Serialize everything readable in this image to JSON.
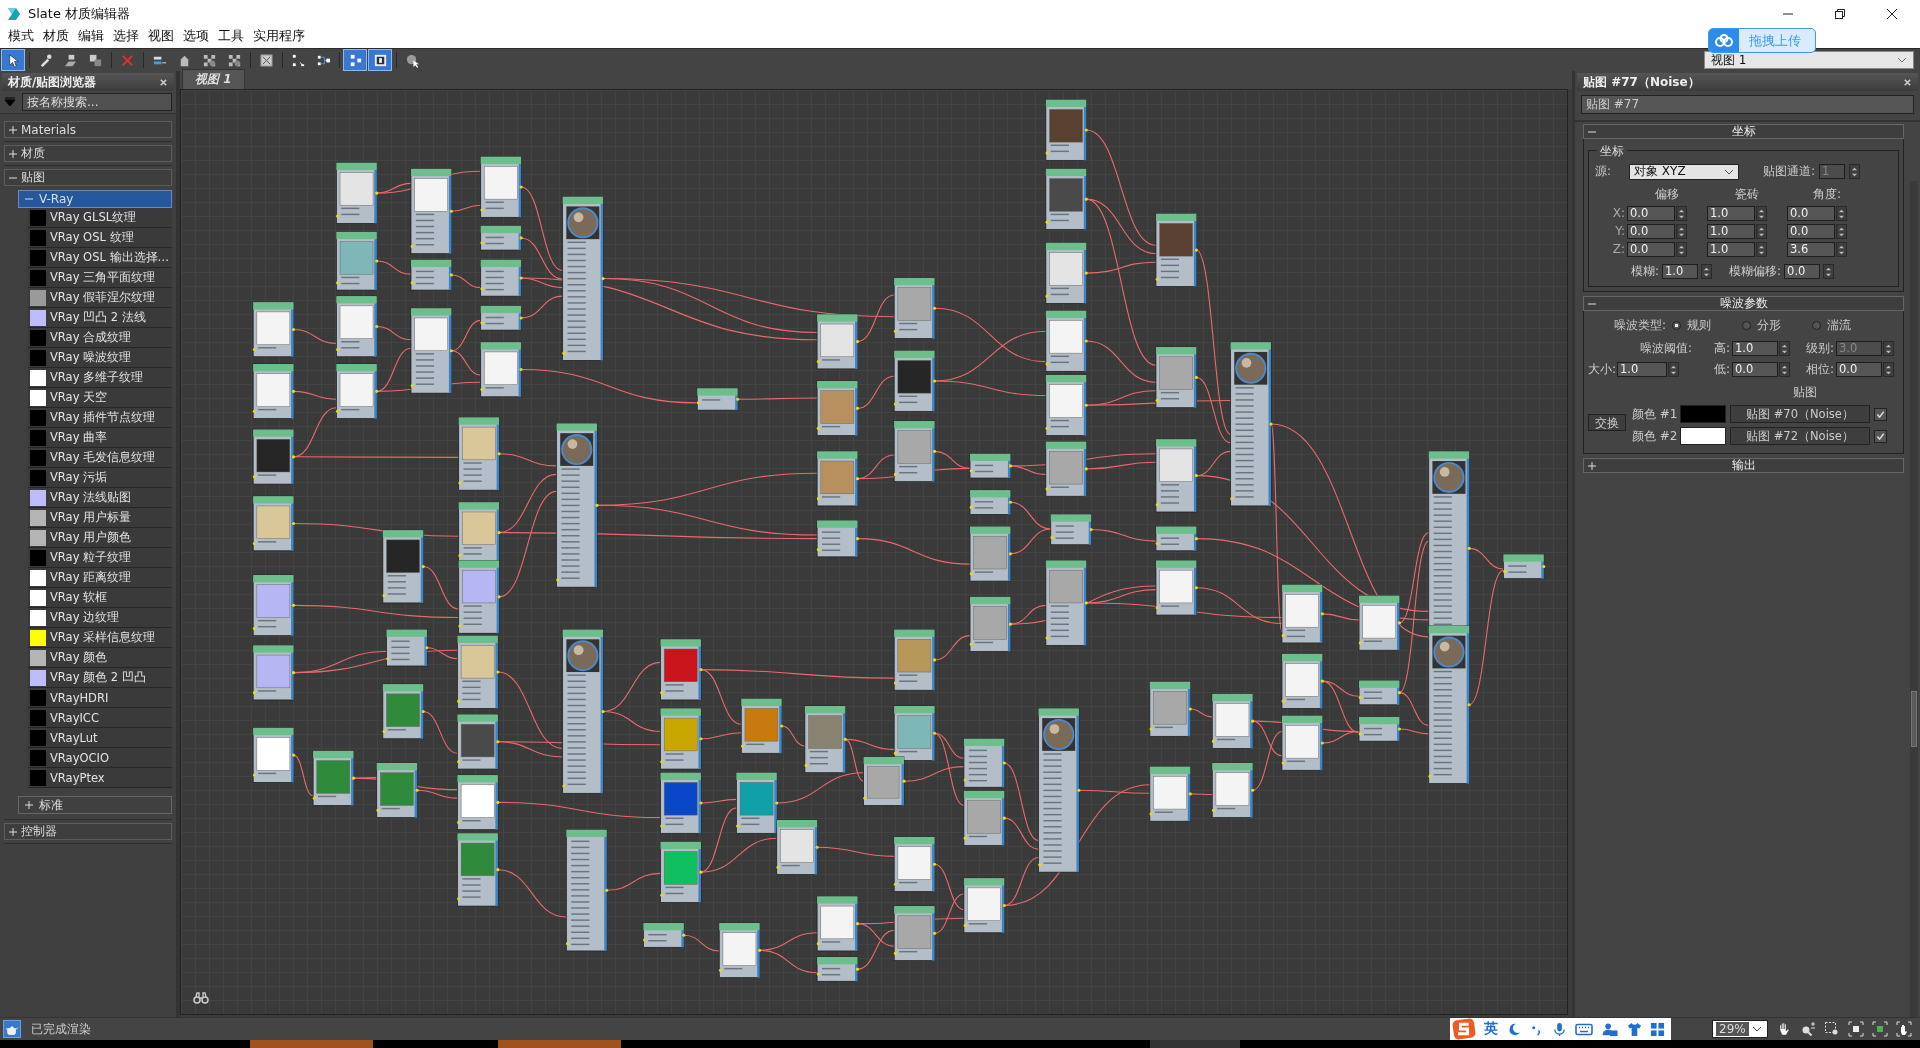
{
  "window": {
    "title": "Slate 材质编辑器"
  },
  "menu": [
    "模式",
    "材质",
    "编辑",
    "选择",
    "视图",
    "选项",
    "工具",
    "实用程序"
  ],
  "toolbar": [
    [
      {
        "kind": "pointer",
        "selected": true
      }
    ],
    [
      {
        "kind": "eyedropper",
        "selected": false
      },
      {
        "kind": "assign",
        "selected": false
      },
      {
        "kind": "copy",
        "selected": false
      }
    ],
    [
      {
        "kind": "delete",
        "selected": false
      }
    ],
    [
      {
        "kind": "link",
        "selected": false
      },
      {
        "kind": "shape",
        "selected": false
      },
      {
        "kind": "checker",
        "selected": false
      },
      {
        "kind": "checker",
        "selected": false
      }
    ],
    [
      {
        "kind": "image",
        "selected": false
      }
    ],
    [
      {
        "kind": "dots",
        "selected": false
      },
      {
        "kind": "tree",
        "selected": false
      }
    ],
    [
      {
        "kind": "nodes",
        "selected": true
      },
      {
        "kind": "panel",
        "selected": true
      }
    ],
    [
      {
        "kind": "sphere",
        "selected": false
      }
    ]
  ],
  "view_select": {
    "value": "视图 1"
  },
  "upload_widget": {
    "label": "拖拽上传"
  },
  "browser": {
    "title": "材质/贴图浏览器",
    "search": {
      "placeholder": "按名称搜索..."
    },
    "groups": [
      {
        "label": "Materials",
        "expanded": false
      },
      {
        "label": "材质",
        "expanded": false
      },
      {
        "label": "贴图",
        "expanded": true,
        "children": [
          {
            "label": "V-Ray",
            "expanded": true,
            "selected": true,
            "items": [
              {
                "label": "VRay GLSL纹理",
                "color": "#000000"
              },
              {
                "label": "VRay OSL 纹理",
                "color": "#000000"
              },
              {
                "label": "VRay OSL 输出选择…",
                "color": "#000000"
              },
              {
                "label": "VRay 三角平面纹理",
                "color": "#000000"
              },
              {
                "label": "VRay 假菲涅尔纹理",
                "color": "#9a9a9a"
              },
              {
                "label": "VRay 凹凸 2 法线",
                "color": "#bcbcff"
              },
              {
                "label": "VRay 合成纹理",
                "color": "#000000"
              },
              {
                "label": "VRay 噪波纹理",
                "color": "#000000"
              },
              {
                "label": "VRay 多维子纹理",
                "color": "#ffffff"
              },
              {
                "label": "VRay 天空",
                "color": "#ffffff"
              },
              {
                "label": "VRay 插件节点纹理",
                "color": "#000000"
              },
              {
                "label": "VRay 曲率",
                "color": "#000000"
              },
              {
                "label": "VRay 毛发信息纹理",
                "color": "#000000"
              },
              {
                "label": "VRay 污垢",
                "color": "#000000"
              },
              {
                "label": "VRay 法线贴图",
                "color": "#bcbcff"
              },
              {
                "label": "VRay 用户标量",
                "color": "#b4b4b4"
              },
              {
                "label": "VRay 用户颜色",
                "color": "#b4b4b4"
              },
              {
                "label": "VRay 粒子纹理",
                "color": "#000000"
              },
              {
                "label": "VRay 距离纹理",
                "color": "#ffffff"
              },
              {
                "label": "VRay 软框",
                "color": "#ffffff"
              },
              {
                "label": "VRay 边纹理",
                "color": "#ffffff"
              },
              {
                "label": "VRay 采样信息纹理",
                "color": "#ffff00"
              },
              {
                "label": "VRay 颜色",
                "color": "#b4b4b4"
              },
              {
                "label": "VRay 颜色 2 凹凸",
                "color": "#bcbcff"
              },
              {
                "label": "VRayHDRI",
                "color": "#000000"
              },
              {
                "label": "VRayICC",
                "color": "#000000"
              },
              {
                "label": "VRayLut",
                "color": "#000000"
              },
              {
                "label": "VRayOCIO",
                "color": "#000000"
              },
              {
                "label": "VRayPtex",
                "color": "#000000"
              }
            ]
          },
          {
            "label": "标准",
            "expanded": false,
            "selected": false
          }
        ]
      },
      {
        "label": "控制器",
        "expanded": false
      }
    ]
  },
  "view_tabs": [
    {
      "label": "视图 1",
      "selected": true
    }
  ],
  "editor": {
    "title": "贴图 #77（Noise）",
    "name": "贴图 #77",
    "coords": {
      "title": "坐标",
      "expanded": true,
      "group": "坐标",
      "source_label": "源:",
      "source": "对象 XYZ",
      "channel": {
        "label": "贴图通道:",
        "value": "1",
        "disabled": true
      },
      "columns": [
        "偏移",
        "瓷砖",
        "角度:"
      ],
      "rows": [
        {
          "axis": "X:",
          "values": [
            "0.0",
            "1.0",
            "0.0"
          ]
        },
        {
          "axis": "Y:",
          "values": [
            "0.0",
            "1.0",
            "0.0"
          ]
        },
        {
          "axis": "Z:",
          "values": [
            "0.0",
            "1.0",
            "3.6"
          ]
        }
      ],
      "blur": {
        "label": "模糊:",
        "value": "1.0",
        "disabled": false
      },
      "blur_offset": {
        "label": "模糊偏移:",
        "value": "0.0",
        "disabled": false
      }
    },
    "noise": {
      "title": "噪波参数",
      "expanded": true,
      "type_label": "噪波类型:",
      "types": [
        {
          "label": "规则",
          "selected": true
        },
        {
          "label": "分形",
          "selected": false
        },
        {
          "label": "湍流",
          "selected": false
        }
      ],
      "threshold_label": "噪波阈值:",
      "high": {
        "label": "高:",
        "value": "1.0",
        "disabled": false
      },
      "levels": {
        "label": "级别:",
        "value": "3.0",
        "disabled": true
      },
      "size": {
        "label": "大小:",
        "value": "1.0",
        "disabled": false
      },
      "low": {
        "label": "低:",
        "value": "0.0",
        "disabled": false
      },
      "phase": {
        "label": "相位:",
        "value": "0.0",
        "disabled": false
      },
      "maps_label": "贴图",
      "swap": "交换",
      "colors": [
        {
          "label": "颜色 #1",
          "color": "#000000",
          "map": "贴图 #70（Noise）",
          "checked": true
        },
        {
          "label": "颜色 #2",
          "color": "#ffffff",
          "map": "贴图 #72（Noise）",
          "checked": true
        }
      ]
    },
    "output": {
      "title": "输出",
      "expanded": false
    }
  },
  "status_bar": {
    "text": "已完成渲染",
    "zoom": "29%"
  },
  "ime_bar": {
    "label": "英"
  }
}
